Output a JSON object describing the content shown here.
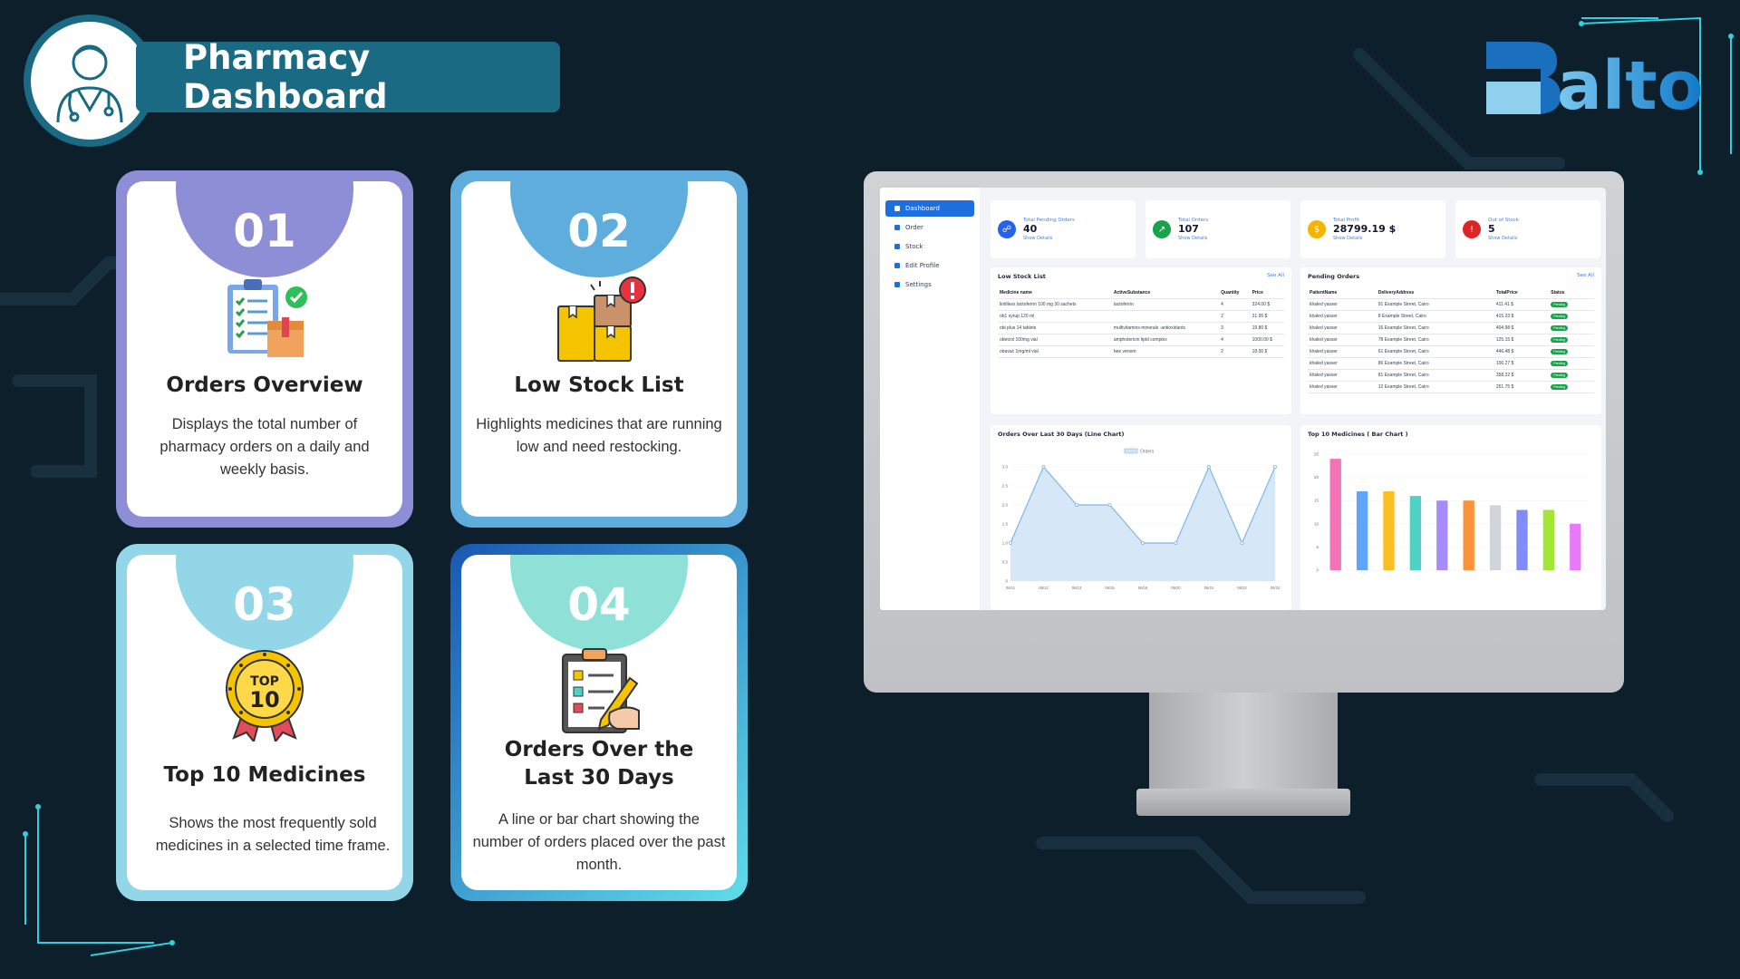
{
  "header": {
    "title": "Pharmacy Dashboard",
    "brand": "Balto"
  },
  "cards": [
    {
      "number": "01",
      "title": "Orders Overview",
      "description": "Displays the total number of pharmacy orders on a daily and weekly basis.",
      "color": "#8e8ed6",
      "icon": "clipboard-box-icon"
    },
    {
      "number": "02",
      "title": "Low Stock List",
      "description": "Highlights medicines that are running low and need restocking.",
      "color": "#5eaddc",
      "icon": "boxes-alert-icon"
    },
    {
      "number": "03",
      "title": "Top 10 Medicines",
      "description": "Shows the most frequently sold medicines in a selected time frame.",
      "color": "#93d6e8",
      "icon": "top-10-badge-icon"
    },
    {
      "number": "04",
      "title": "Orders Over the Last 30 Days",
      "description": "A line or bar chart showing the number of orders placed over the past month.",
      "color": "#8fe0d6",
      "icon": "checklist-pen-icon"
    }
  ],
  "dashboard": {
    "sidebar": [
      {
        "label": "Dashboard",
        "active": true
      },
      {
        "label": "Order",
        "active": false
      },
      {
        "label": "Stock",
        "active": false
      },
      {
        "label": "Edit Profile",
        "active": false
      },
      {
        "label": "Settings",
        "active": false
      }
    ],
    "kpis": [
      {
        "label": "Total Pending Orders",
        "value": "40",
        "link": "Show Details",
        "color": "#2563eb",
        "icon": "cart-icon"
      },
      {
        "label": "Total Orders",
        "value": "107",
        "link": "Show Details",
        "color": "#16a34a",
        "icon": "trend-icon"
      },
      {
        "label": "Total Profit",
        "value": "28799.19 $",
        "link": "Show Details",
        "color": "#f5b400",
        "icon": "dollar-icon"
      },
      {
        "label": "Out of Stock",
        "value": "5",
        "link": "Show Details",
        "color": "#dc2626",
        "icon": "warning-icon"
      }
    ],
    "low_stock": {
      "title": "Low Stock List",
      "see_all": "See All",
      "columns": [
        "Medicine name",
        "ActiveSubstance",
        "Quantity",
        "Price"
      ],
      "rows": [
        [
          "lintilless lactoferrin 100 mg 30 sachets",
          "lactoferrin",
          "4",
          "324.00 $"
        ],
        [
          "ob1 syrup 120 ml",
          "",
          "2",
          "21.95 $"
        ],
        [
          "obi plus 14 tablets",
          "multivitamins-minerals -antioxidants",
          "3",
          "19.80 $"
        ],
        [
          "obetcol 100mg vial",
          "amphotericin lipid complex",
          "4",
          "1000.00 $"
        ],
        [
          "obavac 1mg/ml vial",
          "bee venom",
          "2",
          "18.00 $"
        ]
      ]
    },
    "pending_orders": {
      "title": "Pending Orders",
      "see_all": "See All",
      "columns": [
        "PatientName",
        "DeliveryAddress",
        "TotalPrice",
        "Status"
      ],
      "rows": [
        [
          "khaled yasser",
          "91 Example Street, Cairo",
          "411.41 $",
          "Pending"
        ],
        [
          "khaled yasser",
          "8 Example Street, Cairo",
          "415.33 $",
          "Pending"
        ],
        [
          "khaled yasser",
          "16 Example Street, Cairo",
          "404.98 $",
          "Pending"
        ],
        [
          "khaled yasser",
          "78 Example Street, Cairo",
          "125.15 $",
          "Pending"
        ],
        [
          "khaled yasser",
          "61 Example Street, Cairo",
          "446.48 $",
          "Pending"
        ],
        [
          "khaled yasser",
          "86 Example Street, Cairo",
          "100.27 $",
          "Pending"
        ],
        [
          "khaled yasser",
          "81 Example Street, Cairo",
          "358.22 $",
          "Pending"
        ],
        [
          "khaled yasser",
          "12 Example Street, Cairo",
          "251.75 $",
          "Pending"
        ]
      ]
    },
    "line_chart": {
      "title": "Orders Over Last 30 Days (Line Chart)",
      "legend": "Orders",
      "ylim": [
        0,
        3.0
      ],
      "yticks": [
        "0",
        "0.5",
        "1.0",
        "1.5",
        "2.0",
        "2.5",
        "3.0"
      ],
      "x": [
        "06/11",
        "06/12",
        "06/13",
        "06/15",
        "06/16",
        "06/20",
        "06/21",
        "06/22",
        "06/24"
      ],
      "values": [
        1,
        3,
        2,
        2,
        1,
        1,
        3,
        1,
        3
      ],
      "color": "#7fb6e6"
    },
    "bar_chart": {
      "title": "Top 10 Medicines ( Bar Chart )",
      "ylim": [
        0,
        25
      ],
      "yticks": [
        "0",
        "5",
        "10",
        "15",
        "20",
        "25"
      ],
      "values": [
        24,
        17,
        17,
        16,
        15,
        15,
        14,
        13,
        13,
        10
      ],
      "colors": [
        "#f472b6",
        "#60a5fa",
        "#fbbf24",
        "#4fd1c5",
        "#a78bfa",
        "#fb923c",
        "#d1d5db",
        "#818cf8",
        "#a3e635",
        "#e879f9"
      ]
    }
  }
}
